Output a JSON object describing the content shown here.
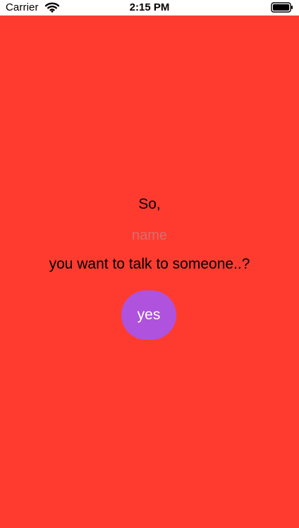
{
  "colors": {
    "background": "#ff3b30",
    "button": "#af52de",
    "button_text": "#ffffff",
    "status_bar": "#ffffff",
    "text": "#000000"
  },
  "status_bar": {
    "carrier": "Carrier",
    "time": "2:15 PM",
    "wifi_icon": "wifi-icon",
    "battery_icon": "battery-icon"
  },
  "main": {
    "greeting": "So,",
    "name_input": {
      "value": "",
      "placeholder": "name"
    },
    "prompt": "you want to talk to someone..?",
    "yes_button": {
      "label": "yes"
    }
  }
}
